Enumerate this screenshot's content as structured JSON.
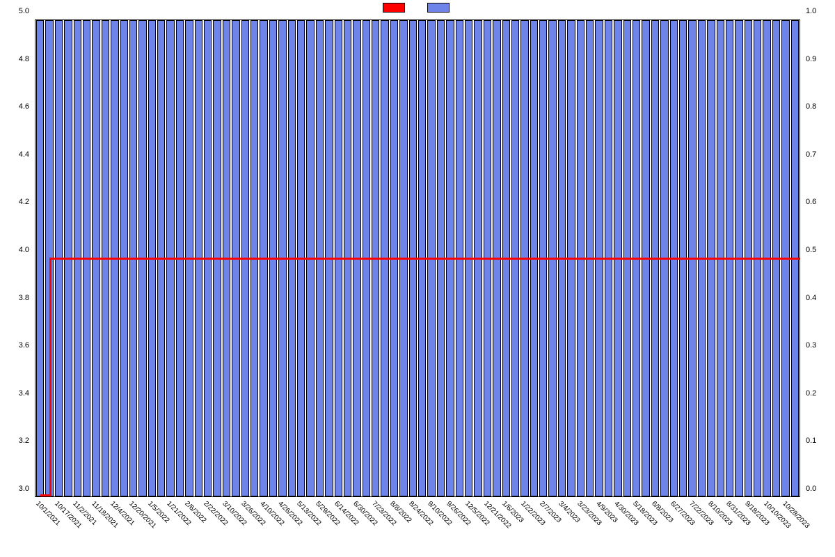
{
  "chart_data": {
    "type": "bar+line",
    "categories": [
      "10/1/2021",
      "10/17/2021",
      "11/2/2021",
      "11/18/2021",
      "12/4/2021",
      "12/20/2021",
      "1/5/2022",
      "1/21/2022",
      "2/6/2022",
      "2/22/2022",
      "3/10/2022",
      "3/26/2022",
      "4/10/2022",
      "4/26/2022",
      "5/13/2022",
      "5/29/2022",
      "6/14/2022",
      "6/30/2022",
      "7/23/2022",
      "8/8/2022",
      "8/24/2022",
      "9/10/2022",
      "9/26/2022",
      "12/5/2022",
      "12/21/2022",
      "1/6/2023",
      "1/22/2023",
      "2/7/2023",
      "3/4/2023",
      "3/23/2023",
      "4/9/2023",
      "4/30/2023",
      "5/18/2023",
      "6/8/2023",
      "6/27/2023",
      "7/22/2023",
      "8/10/2023",
      "8/31/2023",
      "9/18/2023",
      "10/10/2023",
      "10/28/2023"
    ],
    "xticks_shown": [
      "10/1/2021",
      "10/17/2021",
      "11/2/2021",
      "11/18/2021",
      "12/4/2021",
      "12/20/2021",
      "1/5/2022",
      "1/21/2022",
      "2/6/2022",
      "2/22/2022",
      "3/10/2022",
      "3/26/2022",
      "4/10/2022",
      "4/26/2022",
      "5/13/2022",
      "5/29/2022",
      "6/14/2022",
      "6/30/2022",
      "7/23/2022",
      "8/8/2022",
      "8/24/2022",
      "9/10/2022",
      "9/26/2022",
      "12/5/2022",
      "12/21/2022",
      "1/6/2023",
      "1/22/2023",
      "2/7/2023",
      "3/4/2023",
      "3/23/2023",
      "4/9/2023",
      "4/30/2023",
      "5/18/2023",
      "6/8/2023",
      "6/27/2023",
      "7/22/2023",
      "8/10/2023",
      "8/31/2023",
      "9/18/2023",
      "10/10/2023",
      "10/28/2023"
    ],
    "series": [
      {
        "name": "",
        "type": "bar",
        "axis": "right",
        "color": "#6f84e8",
        "values": [
          1,
          1,
          1,
          1,
          1,
          1,
          1,
          1,
          1,
          1,
          1,
          1,
          1,
          1,
          1,
          1,
          1,
          1,
          1,
          1,
          1,
          1,
          1,
          1,
          1,
          1,
          1,
          1,
          1,
          1,
          1,
          1,
          1,
          1,
          1,
          1,
          1,
          1,
          1,
          1,
          1
        ]
      },
      {
        "name": "",
        "type": "line",
        "axis": "left",
        "color": "#ff0000",
        "values": [
          3.0,
          4.0,
          4.0,
          4.0,
          4.0,
          4.0,
          4.0,
          4.0,
          4.0,
          4.0,
          4.0,
          4.0,
          4.0,
          4.0,
          4.0,
          4.0,
          4.0,
          4.0,
          4.0,
          4.0,
          4.0,
          4.0,
          4.0,
          4.0,
          4.0,
          4.0,
          4.0,
          4.0,
          4.0,
          4.0,
          4.0,
          4.0,
          4.0,
          4.0,
          4.0,
          4.0,
          4.0,
          4.0,
          4.0,
          4.0,
          4.0
        ]
      }
    ],
    "y_left": {
      "min": 3.0,
      "max": 5.0,
      "ticks": [
        3.0,
        3.2,
        3.4,
        3.6,
        3.8,
        4.0,
        4.2,
        4.4,
        4.6,
        4.8,
        5.0
      ]
    },
    "y_right": {
      "min": 0.0,
      "max": 1.0,
      "ticks": [
        0.0,
        0.1,
        0.2,
        0.3,
        0.4,
        0.5,
        0.6,
        0.7,
        0.8,
        0.9,
        1.0
      ]
    },
    "legend_order": [
      "line",
      "bar"
    ],
    "title": "",
    "xlabel": "",
    "ylabel_left": "",
    "ylabel_right": ""
  },
  "n_bars": 82
}
